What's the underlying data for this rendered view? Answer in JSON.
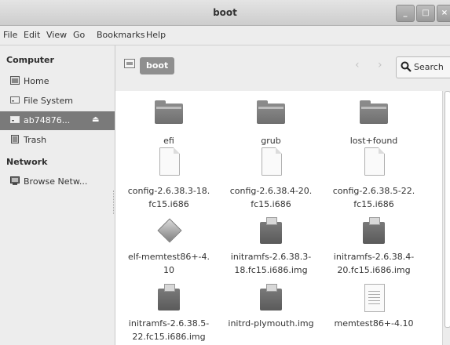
{
  "window": {
    "title": "boot"
  },
  "menubar": [
    "File",
    "Edit",
    "View",
    "Go",
    "Bookmarks",
    "Help"
  ],
  "sidebar": {
    "computer_heading": "Computer",
    "computer_items": [
      {
        "label": "Home",
        "icon": "home-icon"
      },
      {
        "label": "File System",
        "icon": "drive-icon"
      },
      {
        "label": "ab74876...",
        "icon": "volume-icon",
        "selected": true
      },
      {
        "label": "Trash",
        "icon": "trash-icon"
      }
    ],
    "network_heading": "Network",
    "network_items": [
      {
        "label": "Browse Netw...",
        "icon": "network-icon"
      }
    ]
  },
  "toolbar": {
    "path_button": "boot",
    "search_label": "Search"
  },
  "files": [
    {
      "name": "efi",
      "type": "folder"
    },
    {
      "name": "grub",
      "type": "folder"
    },
    {
      "name": "lost+found",
      "type": "folder"
    },
    {
      "name": "config-2.6.38.3-18.\nfc15.i686",
      "type": "document"
    },
    {
      "name": "config-2.6.38.4-20.\nfc15.i686",
      "type": "document"
    },
    {
      "name": "config-2.6.38.5-22.\nfc15.i686",
      "type": "document"
    },
    {
      "name": "elf-memtest86+-4.\n10",
      "type": "executable"
    },
    {
      "name": "initramfs-2.6.38.3-\n18.fc15.i686.img",
      "type": "package"
    },
    {
      "name": "initramfs-2.6.38.4-\n20.fc15.i686.img",
      "type": "package"
    },
    {
      "name": "initramfs-2.6.38.5-\n22.fc15.i686.img",
      "type": "package"
    },
    {
      "name": "initrd-plymouth.img",
      "type": "package"
    },
    {
      "name": "memtest86+-4.10",
      "type": "text"
    }
  ]
}
